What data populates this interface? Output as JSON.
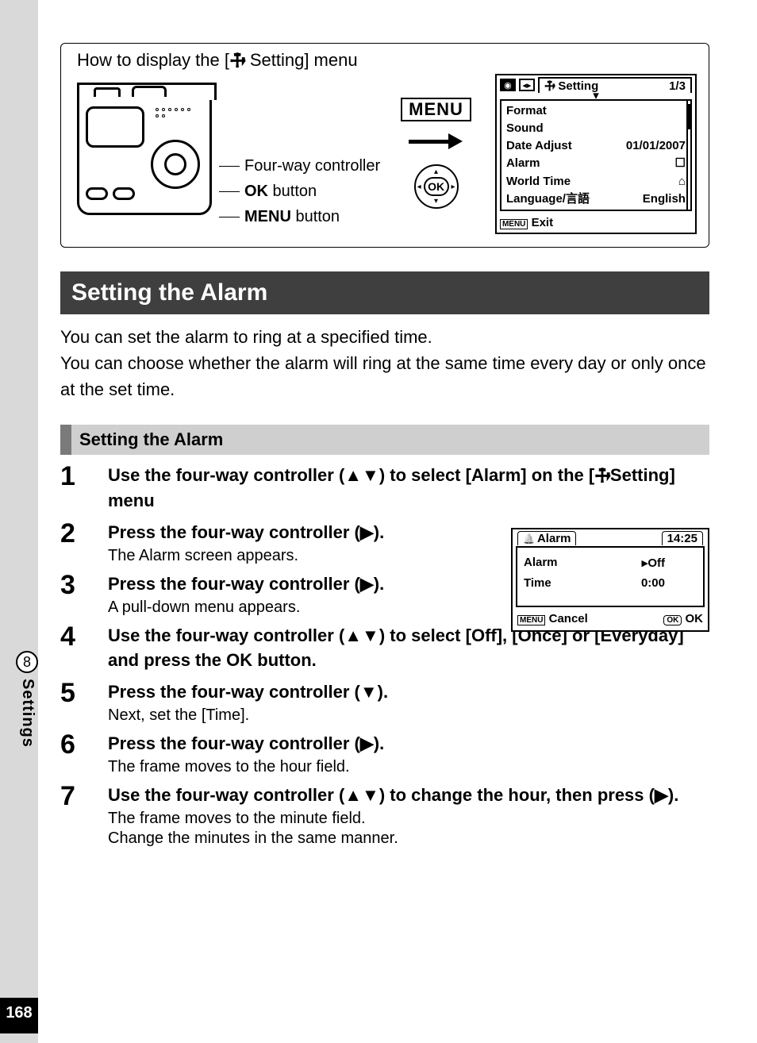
{
  "page_number": "168",
  "chapter_number": "8",
  "chapter_name": "Settings",
  "howto": {
    "title_prefix": "How to display the [",
    "title_suffix": " Setting] menu",
    "label_fourway": "Four-way controller",
    "label_ok_bold": "OK",
    "label_ok_rest": " button",
    "label_menu_bold": "MENU",
    "label_menu_rest": " button",
    "menu_btn": "MENU",
    "ok_btn": "OK"
  },
  "setting_screen": {
    "tab_title": "Setting",
    "page_indicator": "1/3",
    "rows": [
      {
        "label": "Format",
        "value": ""
      },
      {
        "label": "Sound",
        "value": ""
      },
      {
        "label": "Date Adjust",
        "value": "01/01/2007"
      },
      {
        "label": "Alarm",
        "value": "☐"
      },
      {
        "label": "World Time",
        "value": "⌂"
      },
      {
        "label": "Language/言語",
        "value": "English"
      }
    ],
    "exit_btn": "MENU",
    "exit_label": "Exit"
  },
  "heading": "Setting the Alarm",
  "intro_line1": "You can set the alarm to ring at a specified time.",
  "intro_line2": "You can choose whether the alarm will ring at the same time every day or only once at the set time.",
  "subheading": "Setting the Alarm",
  "alarm_screen": {
    "title": "Alarm",
    "time_now": "14:25",
    "row_alarm_label": "Alarm",
    "row_alarm_value": "Off",
    "row_time_label": "Time",
    "row_time_value": "0:00",
    "cancel_btn": "MENU",
    "cancel_label": "Cancel",
    "ok_btn": "OK",
    "ok_label": "OK"
  },
  "steps": {
    "s1": {
      "title_a": "Use the four-way controller (▲▼) to select [Alarm] on the [",
      "title_b": "Setting] menu"
    },
    "s2": {
      "title": "Press the four-way controller (▶).",
      "sub": "The Alarm screen appears."
    },
    "s3": {
      "title": "Press the four-way controller (▶).",
      "sub": "A pull-down menu appears."
    },
    "s4": {
      "title_a": "Use the four-way controller (▲▼) to select [Off], [Once] or [Everyday] and press the ",
      "ok": "OK",
      "title_b": " button."
    },
    "s5": {
      "title": "Press the four-way controller (▼).",
      "sub": "Next, set the [Time]."
    },
    "s6": {
      "title": "Press the four-way controller (▶).",
      "sub": "The frame moves to the hour field."
    },
    "s7": {
      "title": "Use the four-way controller (▲▼) to change the hour, then press (▶).",
      "sub1": "The frame moves to the minute field.",
      "sub2": "Change the minutes in the same manner."
    }
  }
}
